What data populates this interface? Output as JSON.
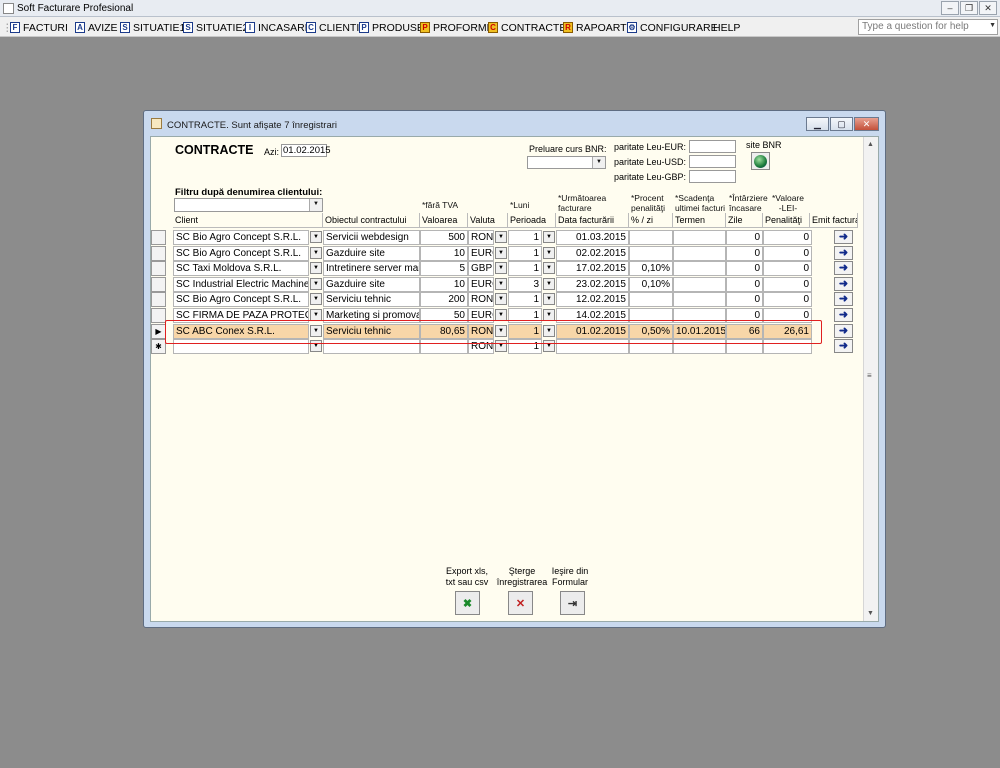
{
  "app": {
    "title": "Soft Facturare Profesional"
  },
  "menu": [
    {
      "label": "FACTURI",
      "icon": "facturi-icon",
      "glyph": "F"
    },
    {
      "label": "AVIZE",
      "icon": "avize-icon",
      "glyph": "A"
    },
    {
      "label": "SITUATIE1",
      "icon": "situatie1-icon",
      "glyph": "S"
    },
    {
      "label": "SITUATIE2",
      "icon": "situatie2-icon",
      "glyph": "S"
    },
    {
      "label": "INCASARI",
      "icon": "incasari-icon",
      "glyph": "I"
    },
    {
      "label": "CLIENTI",
      "icon": "clienti-icon",
      "glyph": "C"
    },
    {
      "label": "PRODUSE",
      "icon": "produse-icon",
      "glyph": "P"
    },
    {
      "label": "PROFORME",
      "icon": "proforme-icon",
      "glyph": "P"
    },
    {
      "label": "CONTRACTE",
      "icon": "contracte-icon",
      "glyph": "C"
    },
    {
      "label": "RAPOARTE",
      "icon": "rapoarte-icon",
      "glyph": "R"
    },
    {
      "label": "CONFIGURARE",
      "icon": "configurare-icon",
      "glyph": "⚙"
    },
    {
      "label": "HELP",
      "icon": "",
      "glyph": ""
    }
  ],
  "help": {
    "placeholder": "Type a question for help"
  },
  "window": {
    "caption": "CONTRACTE. Sunt afişate 7 înregistrari"
  },
  "form": {
    "title": "CONTRACTE",
    "azi_label": "Azi:",
    "azi_value": "01.02.2015",
    "preluare_label": "Preluare curs BNR:",
    "paritate_eur": "paritate Leu-EUR:",
    "paritate_usd": "paritate Leu-USD:",
    "paritate_gbp": "paritate Leu-GBP:",
    "site_bnr": "site BNR",
    "filtru_label": "Filtru după denumirea clientului:"
  },
  "header_top": {
    "fara_tva": "*fără TVA",
    "luni": "*Luni",
    "urmatoarea": "*Următoarea\nfacturare",
    "procent": "*Procent\npenalităţi",
    "scadenta": "*Scadenţa\nultimei facturi",
    "intarziere": "*Întârziere\nîncasare",
    "valoare": "*Valoare\n-LEI-"
  },
  "columns": [
    "Client",
    "Obiectul contractului",
    "Valoarea",
    "Valuta",
    "Perioada",
    "Data facturării",
    "% / zi",
    "Termen",
    "Zile",
    "Penalităţi",
    "Emit factura"
  ],
  "rows": [
    {
      "client": "SC Bio Agro Concept S.R.L.",
      "obiect": "Servicii webdesign",
      "valoare": "500",
      "valuta": "RON",
      "perioada": "1",
      "data": "01.03.2015",
      "procent": "",
      "termen": "",
      "zile": "0",
      "penalitati": "0"
    },
    {
      "client": "SC Bio Agro Concept S.R.L.",
      "obiect": "Gazduire site",
      "valoare": "10",
      "valuta": "EURO",
      "perioada": "1",
      "data": "02.02.2015",
      "procent": "",
      "termen": "",
      "zile": "0",
      "penalitati": "0"
    },
    {
      "client": "SC Taxi Moldova S.R.L.",
      "obiect": "Intretinere server mail",
      "valoare": "5",
      "valuta": "GBP",
      "perioada": "1",
      "data": "17.02.2015",
      "procent": "0,10%",
      "termen": "",
      "zile": "0",
      "penalitati": "0"
    },
    {
      "client": "SC Industrial Electric Machines &",
      "obiect": "Gazduire site",
      "valoare": "10",
      "valuta": "EURO",
      "perioada": "3",
      "data": "23.02.2015",
      "procent": "0,10%",
      "termen": "",
      "zile": "0",
      "penalitati": "0"
    },
    {
      "client": "SC Bio Agro Concept S.R.L.",
      "obiect": "Serviciu tehnic",
      "valoare": "200",
      "valuta": "RON",
      "perioada": "1",
      "data": "12.02.2015",
      "procent": "",
      "termen": "",
      "zile": "0",
      "penalitati": "0"
    },
    {
      "client": "SC FIRMA DE PAZA PROTECTIE",
      "obiect": "Marketing si promovare",
      "valoare": "50",
      "valuta": "EURO",
      "perioada": "1",
      "data": "14.02.2015",
      "procent": "",
      "termen": "",
      "zile": "0",
      "penalitati": "0"
    },
    {
      "client": "SC ABC Conex S.R.L.",
      "obiect": "Serviciu tehnic",
      "valoare": "80,65",
      "valuta": "RON",
      "perioada": "1",
      "data": "01.02.2015",
      "procent": "0,50%",
      "termen": "10.01.2015",
      "zile": "66",
      "penalitati": "26,61"
    },
    {
      "client": "",
      "obiect": "",
      "valoare": "",
      "valuta": "RON",
      "perioada": "1",
      "data": "",
      "procent": "",
      "termen": "",
      "zile": "",
      "penalitati": ""
    }
  ],
  "footer": {
    "export": "Export xls,\ntxt sau csv",
    "sterge": "Şterge\nînregistrarea",
    "iesire": "Ieşire din\nFormular"
  },
  "colors": {
    "highlight_row": "#f8d6a8",
    "annotation": "#e02020"
  }
}
